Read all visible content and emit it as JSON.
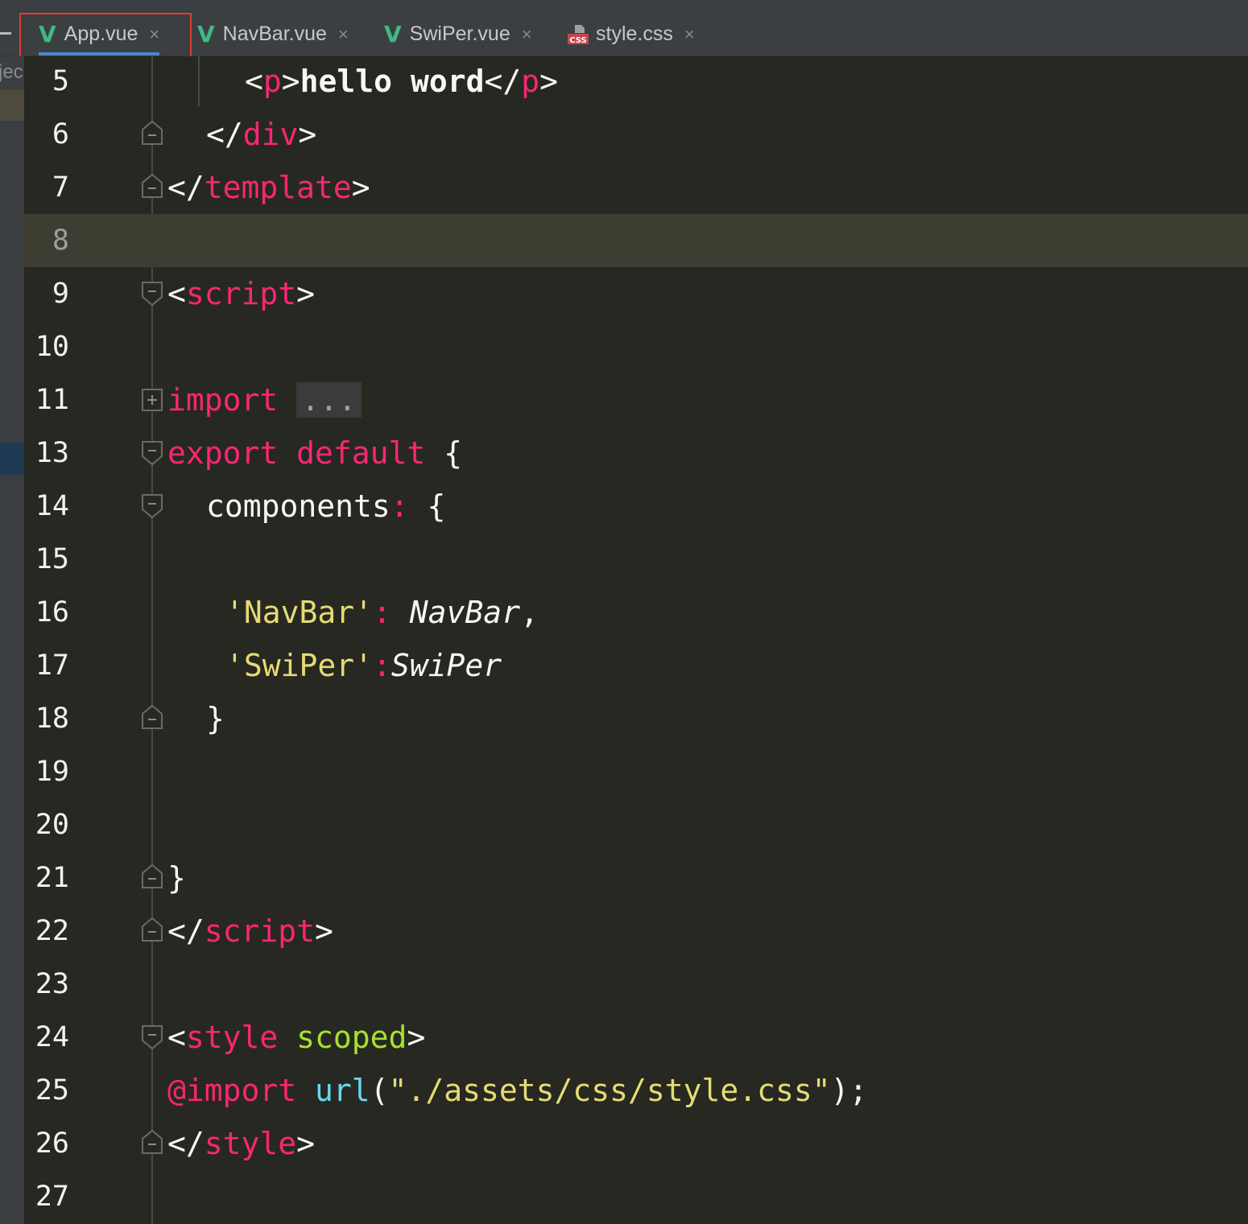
{
  "tabs": [
    {
      "label": "App.vue",
      "icon": "vue-icon",
      "active": true
    },
    {
      "label": "NavBar.vue",
      "icon": "vue-icon",
      "active": false
    },
    {
      "label": "SwiPer.vue",
      "icon": "vue-icon",
      "active": false
    },
    {
      "label": "style.css",
      "icon": "css-icon",
      "active": false
    }
  ],
  "icons": {
    "vue_glyph": "V",
    "css_badge": "CSS",
    "close_glyph": "×",
    "left_panel_text": "jec"
  },
  "colors": {
    "tag": "#f92672",
    "string": "#e6db74",
    "attribute": "#a6e22e",
    "function": "#66d9ef",
    "text": "#f8f8f2",
    "vue": "#41b883",
    "active_tab_underline": "#4a88c7",
    "highlight_box": "#e03c31"
  },
  "editor": {
    "current_line": "8",
    "lines": [
      {
        "num": "5",
        "p1": "<",
        "p2": "p",
        "p3": ">",
        "p4": "hello word",
        "p5": "</",
        "p6": "p",
        "p7": ">"
      },
      {
        "num": "6",
        "p1": "</",
        "p2": "div",
        "p3": ">"
      },
      {
        "num": "7",
        "p1": "</",
        "p2": "template",
        "p3": ">"
      },
      {
        "num": "8"
      },
      {
        "num": "9",
        "p1": "<",
        "p2": "script",
        "p3": ">"
      },
      {
        "num": "10"
      },
      {
        "num": "11",
        "p1": "import",
        "p2": " ",
        "p3": "..."
      },
      {
        "num": "13",
        "p1": "export default",
        "p2": " {"
      },
      {
        "num": "14",
        "p1": "components",
        "p2": ":",
        "p3": " {"
      },
      {
        "num": "15"
      },
      {
        "num": "16",
        "p1": "'NavBar'",
        "p2": ":",
        "p3": " NavBar",
        "p4": ","
      },
      {
        "num": "17",
        "p1": "'SwiPer'",
        "p2": ":",
        "p3": "SwiPer"
      },
      {
        "num": "18",
        "p1": "}"
      },
      {
        "num": "19"
      },
      {
        "num": "20"
      },
      {
        "num": "21",
        "p1": "}"
      },
      {
        "num": "22",
        "p1": "</",
        "p2": "script",
        "p3": ">"
      },
      {
        "num": "23"
      },
      {
        "num": "24",
        "p1": "<",
        "p2": "style",
        "p3": " ",
        "p4": "scoped",
        "p5": ">"
      },
      {
        "num": "25",
        "p1": "@import",
        "p2": " ",
        "p3": "url",
        "p4": "(",
        "p5": "\"./assets/css/style.css\"",
        "p6": ");"
      },
      {
        "num": "26",
        "p1": "</",
        "p2": "style",
        "p3": ">"
      },
      {
        "num": "27"
      }
    ]
  }
}
